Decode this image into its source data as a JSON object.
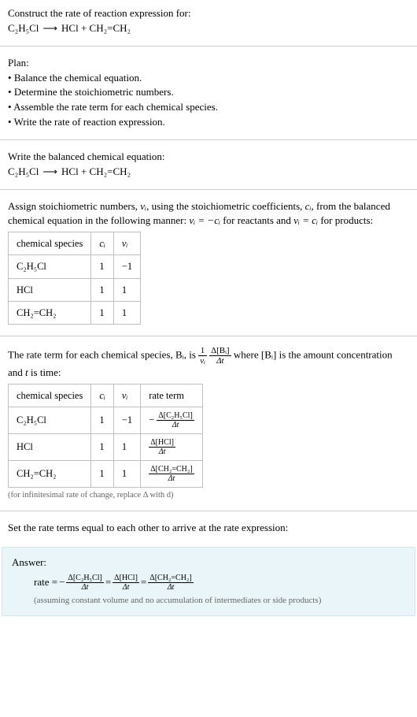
{
  "header": {
    "prompt": "Construct the rate of reaction expression for:",
    "equation_lhs": "C₂H₅Cl",
    "equation_arrow": "⟶",
    "equation_rhs": "HCl + CH₂=CH₂"
  },
  "plan": {
    "title": "Plan:",
    "items": [
      "Balance the chemical equation.",
      "Determine the stoichiometric numbers.",
      "Assemble the rate term for each chemical species.",
      "Write the rate of reaction expression."
    ]
  },
  "balanced": {
    "title": "Write the balanced chemical equation:",
    "equation_lhs": "C₂H₅Cl",
    "equation_arrow": "⟶",
    "equation_rhs": "HCl + CH₂=CH₂"
  },
  "assign": {
    "text_a": "Assign stoichiometric numbers, ",
    "nu_i": "νᵢ",
    "text_b": ", using the stoichiometric coefficients, ",
    "c_i": "cᵢ",
    "text_c": ", from the balanced chemical equation in the following manner: ",
    "rel1": "νᵢ = −cᵢ",
    "text_d": " for reactants and ",
    "rel2": "νᵢ = cᵢ",
    "text_e": " for products:"
  },
  "table1": {
    "headers": {
      "species": "chemical species",
      "ci": "cᵢ",
      "nui": "νᵢ"
    },
    "rows": [
      {
        "species": "C₂H₅Cl",
        "ci": "1",
        "nui": "−1"
      },
      {
        "species": "HCl",
        "ci": "1",
        "nui": "1"
      },
      {
        "species": "CH₂=CH₂",
        "ci": "1",
        "nui": "1"
      }
    ]
  },
  "rateterm": {
    "text_a": "The rate term for each chemical species, ",
    "Bi": "Bᵢ",
    "text_b": ", is ",
    "frac1_num": "1",
    "frac1_den": "νᵢ",
    "frac2_num": "Δ[Bᵢ]",
    "frac2_den": "Δt",
    "text_c": " where ",
    "conc": "[Bᵢ]",
    "text_d": " is the amount concentration and ",
    "t": "t",
    "text_e": " is time:"
  },
  "table2": {
    "headers": {
      "species": "chemical species",
      "ci": "cᵢ",
      "nui": "νᵢ",
      "rate": "rate term"
    },
    "rows": [
      {
        "species": "C₂H₅Cl",
        "ci": "1",
        "nui": "−1",
        "neg": "−",
        "num": "Δ[C₂H₅Cl]",
        "den": "Δt"
      },
      {
        "species": "HCl",
        "ci": "1",
        "nui": "1",
        "neg": "",
        "num": "Δ[HCl]",
        "den": "Δt"
      },
      {
        "species": "CH₂=CH₂",
        "ci": "1",
        "nui": "1",
        "neg": "",
        "num": "Δ[CH₂=CH₂]",
        "den": "Δt"
      }
    ],
    "footnote": "(for infinitesimal rate of change, replace Δ with d)"
  },
  "set_equal": "Set the rate terms equal to each other to arrive at the rate expression:",
  "answer": {
    "title": "Answer:",
    "rate_label": "rate = ",
    "neg": "−",
    "t1_num": "Δ[C₂H₅Cl]",
    "t1_den": "Δt",
    "eq1": " = ",
    "t2_num": "Δ[HCl]",
    "t2_den": "Δt",
    "eq2": " = ",
    "t3_num": "Δ[CH₂=CH₂]",
    "t3_den": "Δt",
    "assume": "(assuming constant volume and no accumulation of intermediates or side products)"
  }
}
